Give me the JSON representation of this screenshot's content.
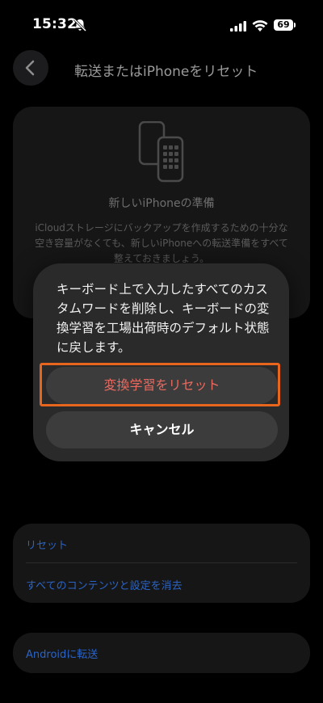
{
  "status_bar": {
    "time": "15:32",
    "battery": "69",
    "icons": [
      "bell-slash-icon",
      "signal-icon",
      "wifi-icon",
      "battery-icon"
    ]
  },
  "nav": {
    "back_icon": "chevron-left-icon",
    "title": "転送またはiPhoneをリセット"
  },
  "prepare_card": {
    "icon": "phone-transfer-icon",
    "title": "新しいiPhoneの準備",
    "description": "iCloudストレージにバックアップを作成するための十分な空き容量がなくても、新しいiPhoneへの転送準備をすべて整えておきましょう。"
  },
  "action_sheet": {
    "message": "キーボード上で入力したすべてのカスタムワードを削除し、キーボードの変換学習を工場出荷時のデフォルト状態に戻します。",
    "reset_label": "変換学習をリセット",
    "cancel_label": "キャンセル"
  },
  "reset_options": {
    "reset_label": "リセット",
    "erase_label": "すべてのコンテンツと設定を消去"
  },
  "android": {
    "label": "Androidに転送"
  },
  "colors": {
    "destructive": "#e86a60",
    "link": "#2a64c7",
    "highlight": "#e8651d"
  }
}
